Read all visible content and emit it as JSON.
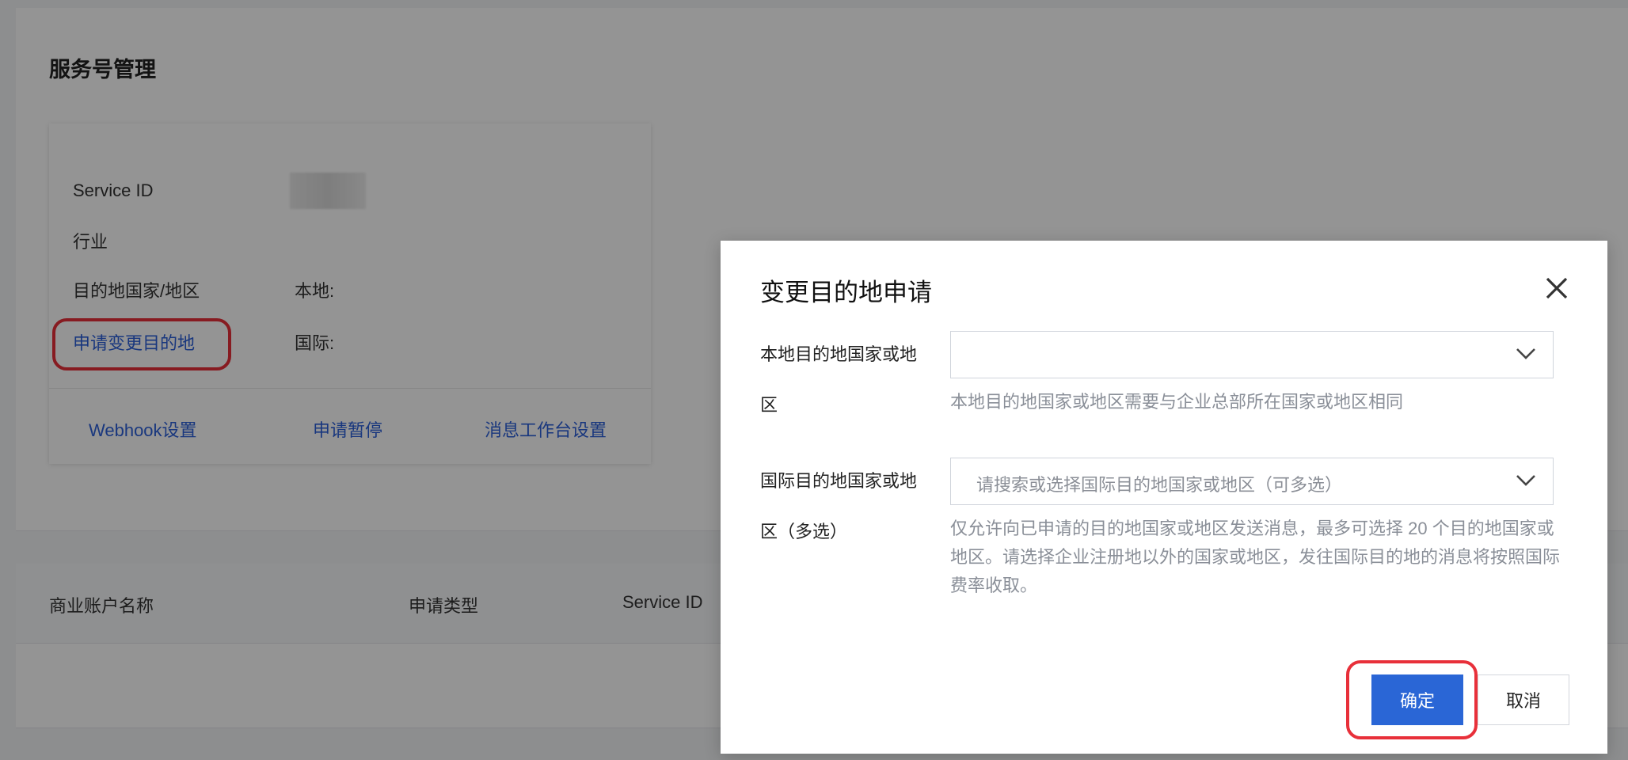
{
  "page": {
    "title": "服务号管理"
  },
  "info_card": {
    "service_id_label": "Service ID",
    "service_id_value": "",
    "industry_label": "行业",
    "destination_label": "目的地国家/地区",
    "local_label": "本地:",
    "international_label": "国际:",
    "change_destination_link": "申请变更目的地",
    "actions": [
      "Webhook设置",
      "申请暂停",
      "消息工作台设置"
    ]
  },
  "table": {
    "columns": [
      "商业账户名称",
      "申请类型",
      "Service ID"
    ]
  },
  "modal": {
    "title": "变更目的地申请",
    "local_field": {
      "label": "本地目的地国家或地区",
      "value": "",
      "hint": "本地目的地国家或地区需要与企业总部所在国家或地区相同"
    },
    "intl_field": {
      "label": "国际目的地国家或地区（多选）",
      "placeholder": "请搜索或选择国际目的地国家或地区（可多选）",
      "hint": "仅允许向已申请的目的地国家或地区发送消息，最多可选择 20 个目的地国家或地区。请选择企业注册地以外的国家或地区，发往国际目的地的消息将按照国际费率收取。"
    },
    "confirm_label": "确定",
    "cancel_label": "取消"
  },
  "colors": {
    "primary": "#2a66d6",
    "link": "#2b5fd9",
    "highlight_ring": "#e8303a",
    "mask": "rgba(0,0,0,0.42)"
  }
}
